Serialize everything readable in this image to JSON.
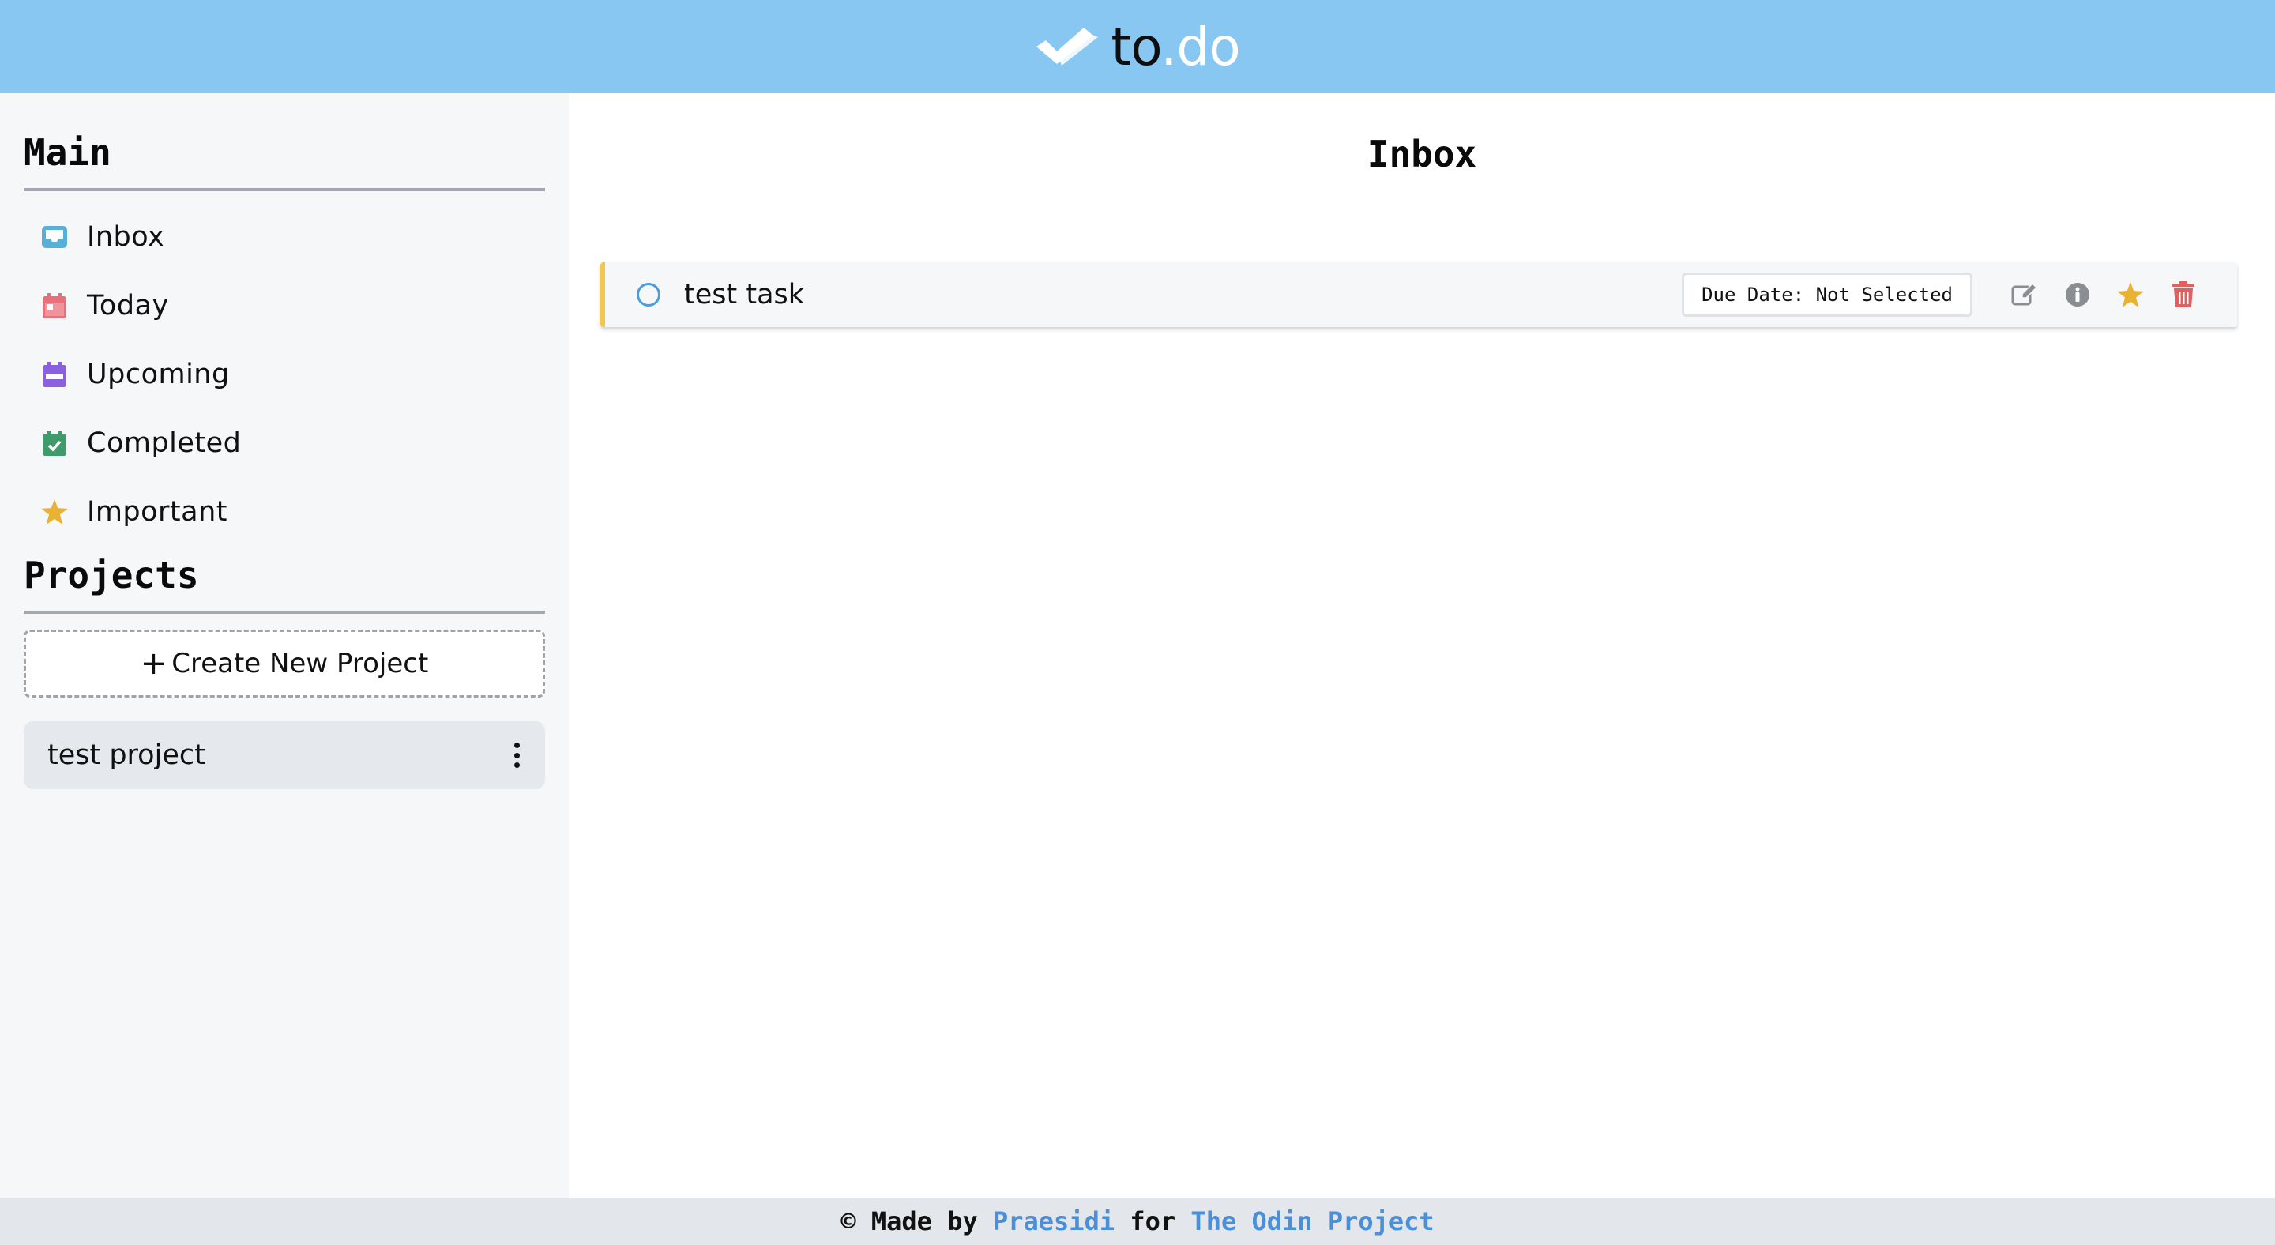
{
  "header": {
    "logo_icon": "double-check-icon",
    "logo_text_main": "to",
    "logo_text_accent": ".do",
    "background": "#89c7f3"
  },
  "sidebar": {
    "main_title": "Main",
    "items": [
      {
        "label": "Inbox",
        "icon": "inbox-icon",
        "color": "#58b0d8"
      },
      {
        "label": "Today",
        "icon": "calendar-day-icon",
        "color": "#e8707a"
      },
      {
        "label": "Upcoming",
        "icon": "calendar-week-icon",
        "color": "#8a5fe0"
      },
      {
        "label": "Completed",
        "icon": "calendar-check-icon",
        "color": "#3f9a6c"
      },
      {
        "label": "Important",
        "icon": "star-icon",
        "color": "#e9b233"
      }
    ],
    "projects_title": "Projects",
    "create_project_label": "Create New Project",
    "projects": [
      {
        "label": "test project"
      }
    ]
  },
  "main": {
    "title": "Inbox",
    "tasks": [
      {
        "title": "test task",
        "due_label": "Due Date: Not Selected",
        "priority_color": "#f1c84b",
        "actions": [
          "edit-icon",
          "info-icon",
          "star-icon",
          "trash-icon"
        ]
      }
    ]
  },
  "footer": {
    "prefix": "© Made by ",
    "author": "Praesidi",
    "middle": " for ",
    "org": "The Odin Project"
  }
}
